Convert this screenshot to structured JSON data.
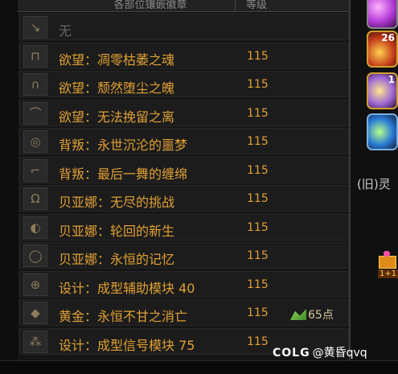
{
  "panel": {
    "header_name": "各部位镶嵌徽章",
    "header_level": "等级"
  },
  "rows": [
    {
      "icon": "weapon-icon",
      "glyph": "↘",
      "name": "无",
      "level": "",
      "empty": true,
      "bonus": null
    },
    {
      "icon": "top-armor-icon",
      "glyph": "⊓",
      "name": "欲望：凋零枯萎之魂",
      "level": "115",
      "empty": false,
      "bonus": null
    },
    {
      "icon": "pants-icon",
      "glyph": "∩",
      "name": "欲望：颓然堕尘之魄",
      "level": "115",
      "empty": false,
      "bonus": null
    },
    {
      "icon": "shoulder-icon",
      "glyph": "⌒",
      "name": "欲望：无法挽留之离",
      "level": "115",
      "empty": false,
      "bonus": null
    },
    {
      "icon": "belt-icon",
      "glyph": "◎",
      "name": "背叛：永世沉沦的噩梦",
      "level": "115",
      "empty": false,
      "bonus": null
    },
    {
      "icon": "shoes-icon",
      "glyph": "⌐",
      "name": "背叛：最后一舞的缠绵",
      "level": "115",
      "empty": false,
      "bonus": null
    },
    {
      "icon": "necklace-icon",
      "glyph": "Ω",
      "name": "贝亚娜：无尽的挑战",
      "level": "115",
      "empty": false,
      "bonus": null
    },
    {
      "icon": "bracelet-icon",
      "glyph": "◐",
      "name": "贝亚娜：轮回的新生",
      "level": "115",
      "empty": false,
      "bonus": null
    },
    {
      "icon": "ring-icon",
      "glyph": "◯",
      "name": "贝亚娜：永恒的记忆",
      "level": "115",
      "empty": false,
      "bonus": null
    },
    {
      "icon": "support-icon",
      "glyph": "⊕",
      "name": "设计：成型辅助模块 40",
      "level": "115",
      "empty": false,
      "bonus": null
    },
    {
      "icon": "magic-stone-icon",
      "glyph": "◆",
      "name": "黄金：永恒不甘之消亡",
      "level": "115",
      "empty": false,
      "bonus": {
        "value": "65",
        "unit": "点"
      }
    },
    {
      "icon": "earring-icon",
      "glyph": "⁂",
      "name": "设计：成型信号模块 75",
      "level": "115",
      "empty": false,
      "bonus": null
    }
  ],
  "right_panel": {
    "skill_counts": [
      "",
      "26",
      "1",
      ""
    ],
    "old_text": "(旧)灵",
    "gift_label": "1+1"
  },
  "watermark": {
    "logo": "COLG",
    "text": "@黄昏qvq"
  }
}
